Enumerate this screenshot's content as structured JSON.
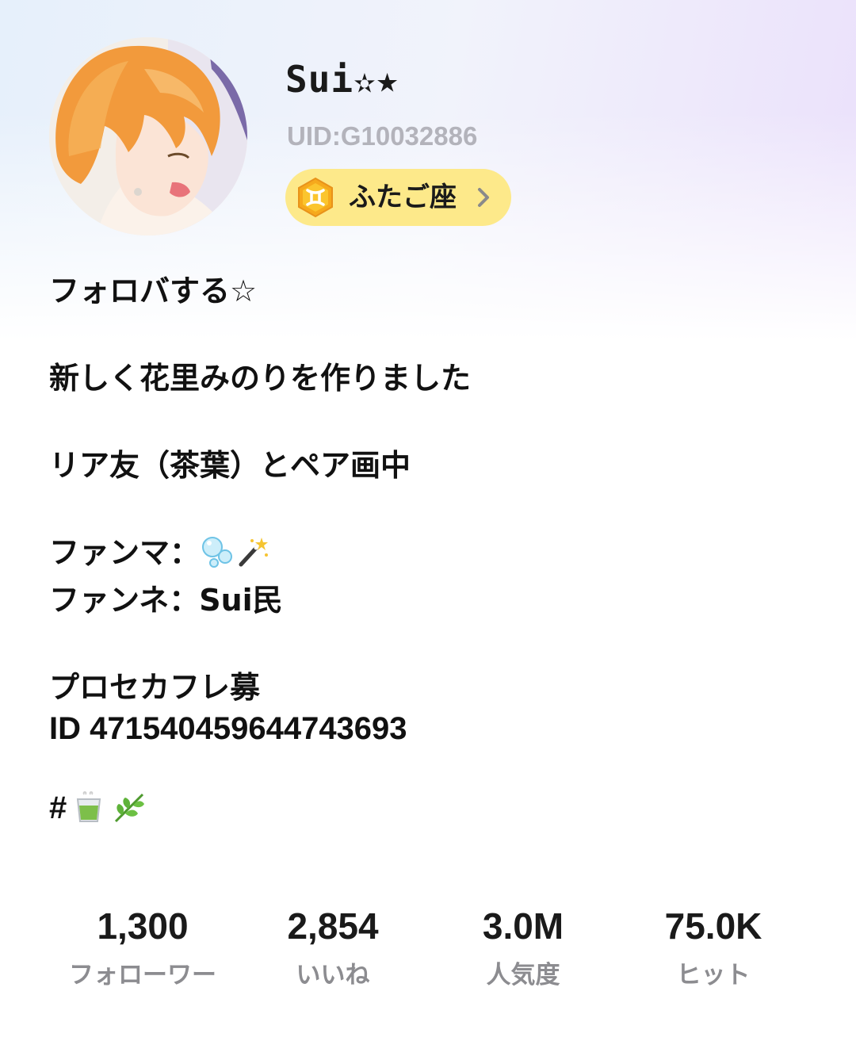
{
  "profile": {
    "display_name": "Sui✫★",
    "uid": "UID:G10032886",
    "zodiac": {
      "label": "ふたご座",
      "icon": "gemini-icon",
      "pill_color": "#fde98a",
      "icon_color": "#f6a91c"
    },
    "avatar_icon": "avatar-illustration"
  },
  "bio": {
    "lines": [
      "フォロバする☆",
      "新しく花里みのりを作りました",
      "リア友（茶葉）とペア画中",
      "ファンマ：",
      "ファンネ：Sui民",
      "プロセカフレ募",
      "ID 4715404596447436​93",
      "#"
    ],
    "fan_mark_icons": [
      "bubbles-icon",
      "magic-wand-icon"
    ],
    "hashtag_icons": [
      "green-tea-icon",
      "herb-icon"
    ]
  },
  "stats": [
    {
      "value": "1,300",
      "label": "フォローワー"
    },
    {
      "value": "2,854",
      "label": "いいね"
    },
    {
      "value": "3.0M",
      "label": "人気度"
    },
    {
      "value": "75.0K",
      "label": "ヒット"
    }
  ]
}
